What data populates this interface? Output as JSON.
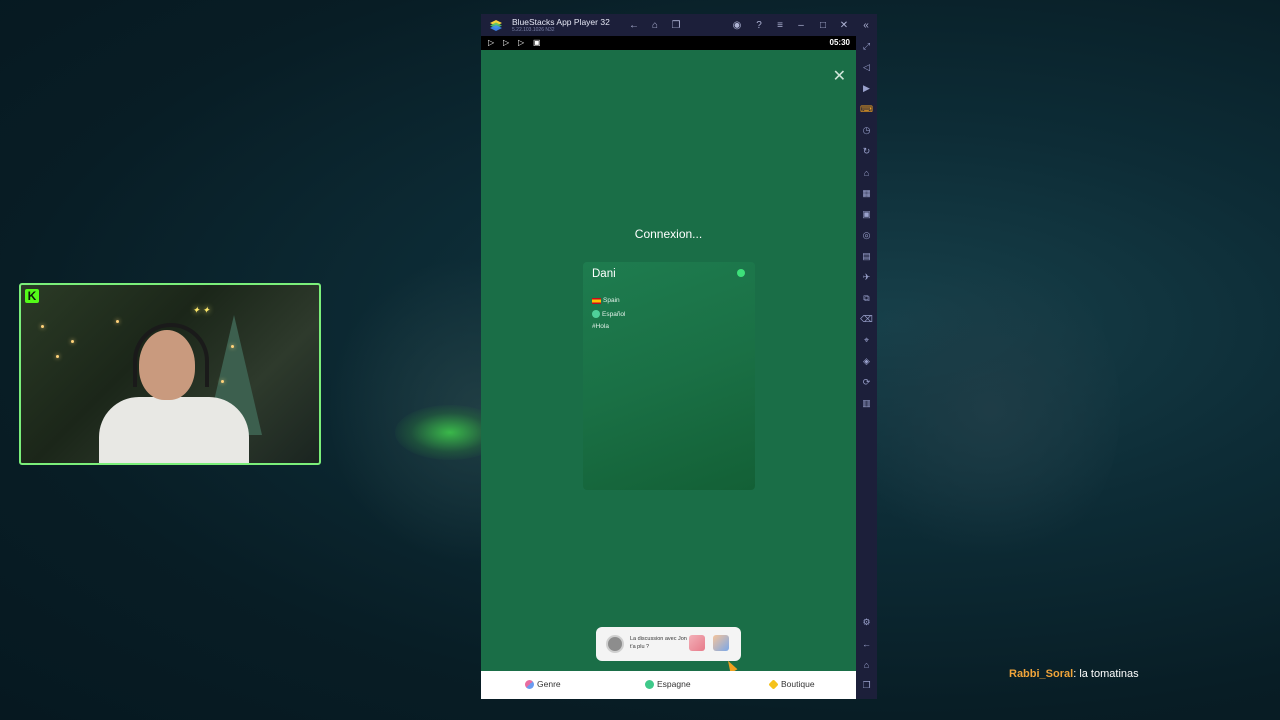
{
  "window": {
    "title": "BlueStacks App Player 32",
    "version": "5.22.103.1026 N32"
  },
  "android": {
    "status_time": "05:30"
  },
  "app": {
    "status_text": "Connexion...",
    "profile": {
      "name": "Dani",
      "country": "Spain",
      "language": "Español",
      "tag": "#Hola",
      "online": true
    },
    "notification": {
      "text": "La discussion avec Jon t'a plu ?"
    },
    "bottom_nav": [
      {
        "label": "Genre",
        "icon": "gender-icon"
      },
      {
        "label": "Espagne",
        "icon": "country-icon"
      },
      {
        "label": "Boutique",
        "icon": "diamond-icon"
      }
    ]
  },
  "chat": {
    "username": "Rabbi_Soral",
    "separator": ":",
    "message": "la tomatinas"
  },
  "colors": {
    "app_green": "#1a6e47",
    "bluestacks_chrome": "#1c1f3a",
    "webcam_border": "#7bef7a",
    "chat_username": "#f0a43a"
  }
}
